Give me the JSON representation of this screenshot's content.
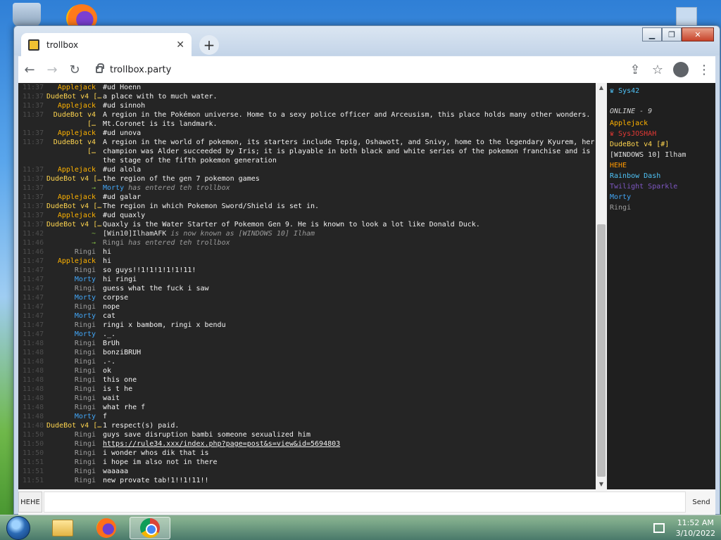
{
  "browser": {
    "tab_title": "trollbox",
    "url": "trollbox.party"
  },
  "chat": [
    {
      "time": "11:37",
      "nick": "Applejack",
      "color": "#ffb300",
      "text": "#ud Hoenn"
    },
    {
      "time": "11:37",
      "nick": "DudeBot v4 […",
      "color": "#ffd54f",
      "text": "a place with to much water."
    },
    {
      "time": "11:37",
      "nick": "Applejack",
      "color": "#ffb300",
      "text": "#ud sinnoh"
    },
    {
      "time": "11:37",
      "nick": "DudeBot v4 […",
      "color": "#ffd54f",
      "text": "A region in the Pokémon universe. Home to a sexy police officer and Arceusism, this place holds many other wonders. Mt.Coronet is its landmark.",
      "lines": 2
    },
    {
      "time": "11:37",
      "nick": "Applejack",
      "color": "#ffb300",
      "text": "#ud unova"
    },
    {
      "time": "11:37",
      "nick": "DudeBot v4 […",
      "color": "#ffd54f",
      "text": "A region in the world of pokemon, its starters include Tepig, Oshawott, and Snivy, home to the legendary Kyurem, her champion was Alder succeeded by Iris; it is playable in both black and white series of the pokemon franchise and is the stage of the fifth pokemon generation",
      "lines": 3
    },
    {
      "time": "11:37",
      "nick": "Applejack",
      "color": "#ffb300",
      "text": "#ud alola"
    },
    {
      "time": "11:37",
      "nick": "DudeBot v4 […",
      "color": "#ffd54f",
      "text": "the region of the gen 7 pokemon games"
    },
    {
      "time": "11:37",
      "nick": "→",
      "color": "#7cb342",
      "system": true,
      "who": "Morty",
      "who_color": "#42a5f5",
      "text": " has entered teh trollbox"
    },
    {
      "time": "11:37",
      "nick": "Applejack",
      "color": "#ffb300",
      "text": "#ud galar"
    },
    {
      "time": "11:37",
      "nick": "DudeBot v4 […",
      "color": "#ffd54f",
      "text": "The region in which Pokemon Sword/Shield is set in."
    },
    {
      "time": "11:37",
      "nick": "Applejack",
      "color": "#ffb300",
      "text": "#ud quaxly"
    },
    {
      "time": "11:37",
      "nick": "DudeBot v4 […",
      "color": "#ffd54f",
      "text": "Quaxly is the Water Starter of Pokemon Gen 9. He is known to look a lot like Donald Duck."
    },
    {
      "time": "11:42",
      "nick": "~",
      "color": "#7cb342",
      "system": true,
      "who": "[Win10]IlhamAFK",
      "who_color": "#e0e0e0",
      "text": " is now known as [WINDOWS 10] Ilham",
      "after_normal": true
    },
    {
      "time": "11:46",
      "nick": "→",
      "color": "#7cb342",
      "system": true,
      "who": "Ringi",
      "who_color": "#9e9e9e",
      "text": " has entered teh trollbox"
    },
    {
      "time": "11:46",
      "nick": "Ringi",
      "color": "#9e9e9e",
      "text": "hi"
    },
    {
      "time": "11:47",
      "nick": "Applejack",
      "color": "#ffb300",
      "text": "hi"
    },
    {
      "time": "11:47",
      "nick": "Ringi",
      "color": "#9e9e9e",
      "text": "so guys!!1!1!1!1!1!11!"
    },
    {
      "time": "11:47",
      "nick": "Morty",
      "color": "#42a5f5",
      "text": "hi ringi"
    },
    {
      "time": "11:47",
      "nick": "Ringi",
      "color": "#9e9e9e",
      "text": "guess what the fuck i saw"
    },
    {
      "time": "11:47",
      "nick": "Morty",
      "color": "#42a5f5",
      "text": "corpse"
    },
    {
      "time": "11:47",
      "nick": "Ringi",
      "color": "#9e9e9e",
      "text": "nope"
    },
    {
      "time": "11:47",
      "nick": "Morty",
      "color": "#42a5f5",
      "text": "cat"
    },
    {
      "time": "11:47",
      "nick": "Ringi",
      "color": "#9e9e9e",
      "text": "ringi x bambom, ringi x bendu"
    },
    {
      "time": "11:47",
      "nick": "Morty",
      "color": "#42a5f5",
      "text": "._."
    },
    {
      "time": "11:48",
      "nick": "Ringi",
      "color": "#9e9e9e",
      "text": "BrUh"
    },
    {
      "time": "11:48",
      "nick": "Ringi",
      "color": "#9e9e9e",
      "text": "bonziBRUH"
    },
    {
      "time": "11:48",
      "nick": "Ringi",
      "color": "#9e9e9e",
      "text": ".-."
    },
    {
      "time": "11:48",
      "nick": "Ringi",
      "color": "#9e9e9e",
      "text": "ok"
    },
    {
      "time": "11:48",
      "nick": "Ringi",
      "color": "#9e9e9e",
      "text": "this one"
    },
    {
      "time": "11:48",
      "nick": "Ringi",
      "color": "#9e9e9e",
      "text": "is t he"
    },
    {
      "time": "11:48",
      "nick": "Ringi",
      "color": "#9e9e9e",
      "text": "wait"
    },
    {
      "time": "11:48",
      "nick": "Ringi",
      "color": "#9e9e9e",
      "text": "what rhe f"
    },
    {
      "time": "11:48",
      "nick": "Morty",
      "color": "#42a5f5",
      "text": "f"
    },
    {
      "time": "11:48",
      "nick": "DudeBot v4 […",
      "color": "#ffd54f",
      "text": "1 respect(s) paid."
    },
    {
      "time": "11:50",
      "nick": "Ringi",
      "color": "#9e9e9e",
      "text": "guys save disruption bambi someone sexualized him"
    },
    {
      "time": "11:50",
      "nick": "Ringi",
      "color": "#9e9e9e",
      "text": "https://rule34.xxx/index.php?page=post&s=view&id=5694803",
      "link": true
    },
    {
      "time": "11:50",
      "nick": "Ringi",
      "color": "#9e9e9e",
      "text": "i wonder whos dik that is"
    },
    {
      "time": "11:51",
      "nick": "Ringi",
      "color": "#9e9e9e",
      "text": "i hope im also not in there"
    },
    {
      "time": "11:51",
      "nick": "Ringi",
      "color": "#9e9e9e",
      "text": "waaaaa"
    },
    {
      "time": "11:51",
      "nick": "Ringi",
      "color": "#9e9e9e",
      "text": "new provate tab!1!!1!11!!"
    }
  ],
  "userlist": {
    "me": "Sys42",
    "me_icon": "♛",
    "online_label": "ONLINE - 9",
    "users": [
      {
        "name": "Applejack",
        "color": "#ffb300"
      },
      {
        "name": "♛ SysJOSHAH",
        "color": "#e53935"
      },
      {
        "name": "DudeBot v4 [#]",
        "color": "#ffd54f"
      },
      {
        "name": "[WINDOWS 10] Ilham",
        "color": "#e0e0e0"
      },
      {
        "name": "HEHE",
        "color": "#ff9800"
      },
      {
        "name": "Rainbow Dash",
        "color": "#4fc3f7"
      },
      {
        "name": "Twilight Sparkle",
        "color": "#7e57c2"
      },
      {
        "name": "Morty",
        "color": "#42a5f5"
      },
      {
        "name": "Ringi",
        "color": "#9e9e9e"
      }
    ]
  },
  "input": {
    "nick_button": "HEHE",
    "value": "",
    "send": "Send"
  },
  "taskbar": {
    "time": "11:52 AM",
    "date": "3/10/2022"
  }
}
